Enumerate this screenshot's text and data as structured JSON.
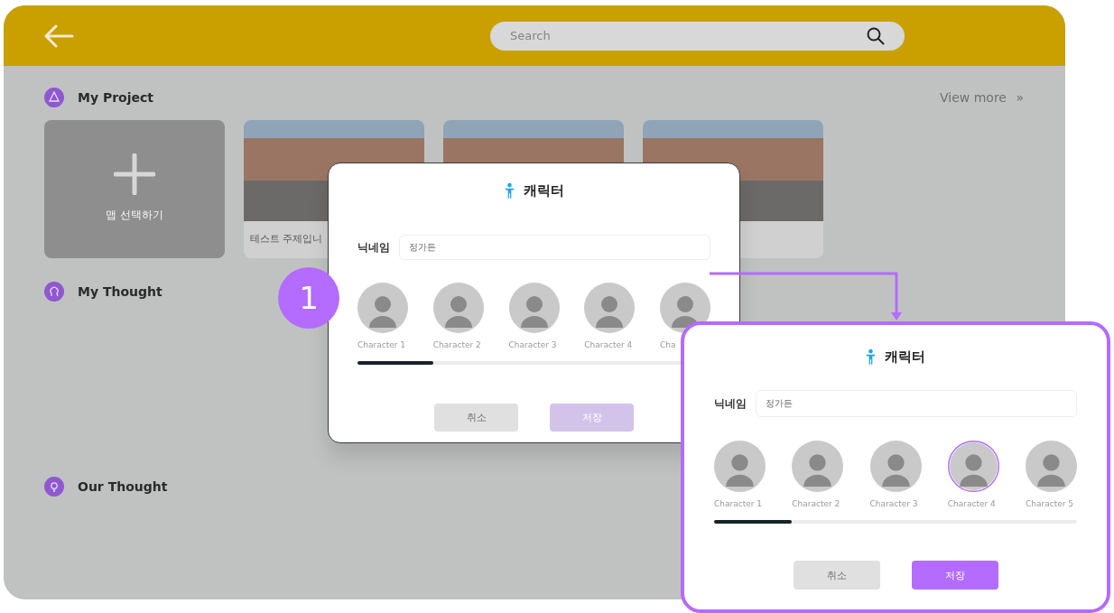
{
  "app": {
    "search": {
      "placeholder": "Search"
    }
  },
  "sections": [
    {
      "title": "My Project",
      "link": "View more",
      "link_icon": "»",
      "cards": [
        {
          "kind": "add",
          "label": "맵 선택하기"
        },
        {
          "kind": "photo",
          "label": "테스트 주제입니"
        },
        {
          "kind": "photo"
        },
        {
          "kind": "photo"
        }
      ]
    },
    {
      "title": "My Thought"
    },
    {
      "title": "Our Thought"
    }
  ],
  "dialogs": [
    {
      "title": "캐릭터",
      "nickname_label": "닉네임",
      "nickname": "정가든",
      "characters": [
        {
          "label": "Character 1",
          "selected": false
        },
        {
          "label": "Character 2",
          "selected": false
        },
        {
          "label": "Character 3",
          "selected": false
        },
        {
          "label": "Character 4",
          "selected": false
        },
        {
          "label": "Cha",
          "selected": false
        }
      ],
      "buttons": [
        {
          "kind": "cancel",
          "label": "취소",
          "disabled": false
        },
        {
          "kind": "save",
          "label": "저장",
          "disabled": true
        }
      ]
    },
    {
      "title": "캐릭터",
      "nickname_label": "닉네임",
      "nickname": "정가든",
      "characters": [
        {
          "label": "Character 1",
          "selected": false
        },
        {
          "label": "Character 2",
          "selected": false
        },
        {
          "label": "Character 3",
          "selected": false
        },
        {
          "label": "Character 4",
          "selected": true
        },
        {
          "label": "Character 5",
          "selected": false
        }
      ],
      "buttons": [
        {
          "kind": "cancel",
          "label": "취소",
          "disabled": false
        },
        {
          "kind": "save",
          "label": "저장",
          "disabled": false
        }
      ]
    }
  ],
  "callout": {
    "number": "1"
  }
}
